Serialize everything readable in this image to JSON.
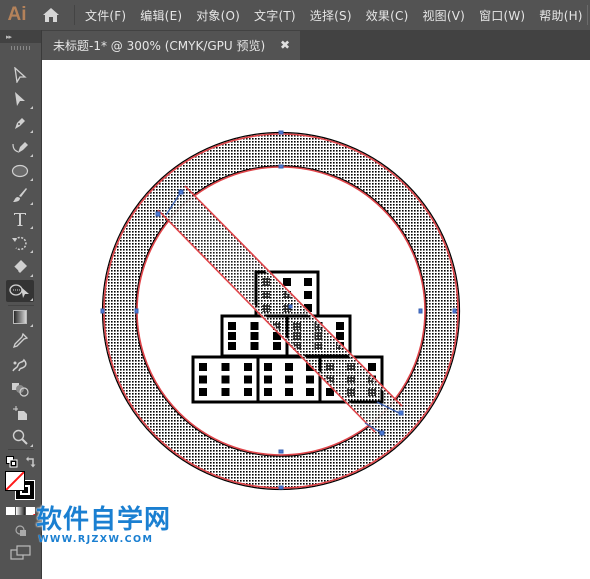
{
  "app": {
    "logo": "Ai",
    "home_icon": "home-icon"
  },
  "menu": {
    "items": [
      {
        "label": "文件(F)"
      },
      {
        "label": "编辑(E)"
      },
      {
        "label": "对象(O)"
      },
      {
        "label": "文字(T)"
      },
      {
        "label": "选择(S)"
      },
      {
        "label": "效果(C)"
      },
      {
        "label": "视图(V)"
      },
      {
        "label": "窗口(W)"
      },
      {
        "label": "帮助(H)"
      }
    ]
  },
  "document_tab": {
    "title": "未标题-1* @ 300% (CMYK/GPU 预览)",
    "close_glyph": "✖"
  },
  "toolbar": {
    "collapse_glyph": "▸▸",
    "tools": [
      {
        "name": "selection-tool",
        "icon": "arrow-outline-icon"
      },
      {
        "name": "direct-selection-tool",
        "icon": "arrow-filled-icon"
      },
      {
        "name": "pen-tool",
        "icon": "pen-icon"
      },
      {
        "name": "curvature-tool",
        "icon": "curvature-pen-icon"
      },
      {
        "name": "ellipse-tool",
        "icon": "ellipse-icon"
      },
      {
        "name": "paintbrush-tool",
        "icon": "brush-icon"
      },
      {
        "name": "type-tool",
        "icon": "type-icon",
        "glyph": "T"
      },
      {
        "name": "rotate-tool",
        "icon": "rotate-icon"
      },
      {
        "name": "eraser-tool",
        "icon": "eraser-icon"
      },
      {
        "name": "shape-builder-tool",
        "icon": "shape-builder-icon",
        "active": true
      },
      {
        "name": "gradient-tool",
        "icon": "gradient-icon"
      },
      {
        "name": "eyedropper-tool",
        "icon": "eyedropper-icon"
      },
      {
        "name": "puppet-warp-tool",
        "icon": "puppet-warp-icon"
      },
      {
        "name": "blend-tool",
        "icon": "blend-icon"
      },
      {
        "name": "artboard-tool",
        "icon": "artboard-icon"
      },
      {
        "name": "zoom-tool",
        "icon": "magnifier-icon"
      }
    ],
    "fill": "none",
    "stroke": "#000000"
  },
  "artwork": {
    "description": "No-buildings prohibition sign",
    "stroke_color": "#e0454a",
    "path_color": "#000000",
    "anchor_color": "#4a7bd8",
    "pattern_fill": "dot-screen"
  },
  "watermark": {
    "title": "软件自学网",
    "url": "WWW.RJZXW.COM",
    "color": "#1a7fd1"
  }
}
